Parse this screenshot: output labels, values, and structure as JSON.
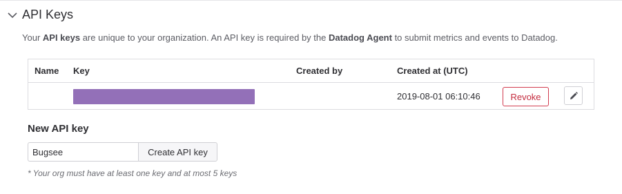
{
  "section": {
    "title": "API Keys",
    "description_parts": [
      "Your ",
      "API keys",
      " are unique to your organization. An API key is required by the ",
      "Datadog Agent",
      " to submit metrics and events to Datadog."
    ]
  },
  "table": {
    "headers": {
      "name": "Name",
      "key": "Key",
      "created_by": "Created by",
      "created_at": "Created at (UTC)"
    },
    "rows": [
      {
        "name": "",
        "key": "",
        "created_by": "",
        "created_at": "2019-08-01 06:10:46",
        "revoke_label": "Revoke"
      }
    ]
  },
  "new_key": {
    "title": "New API key",
    "input_value": "Bugsee",
    "create_label": "Create API key",
    "note": "* Your org must have at least one key and at most 5 keys"
  },
  "icons": {
    "toggle": "chevron-down-icon",
    "edit": "pencil-icon"
  },
  "colors": {
    "key_mask": "#9370b8",
    "revoke": "#c42b3e"
  }
}
